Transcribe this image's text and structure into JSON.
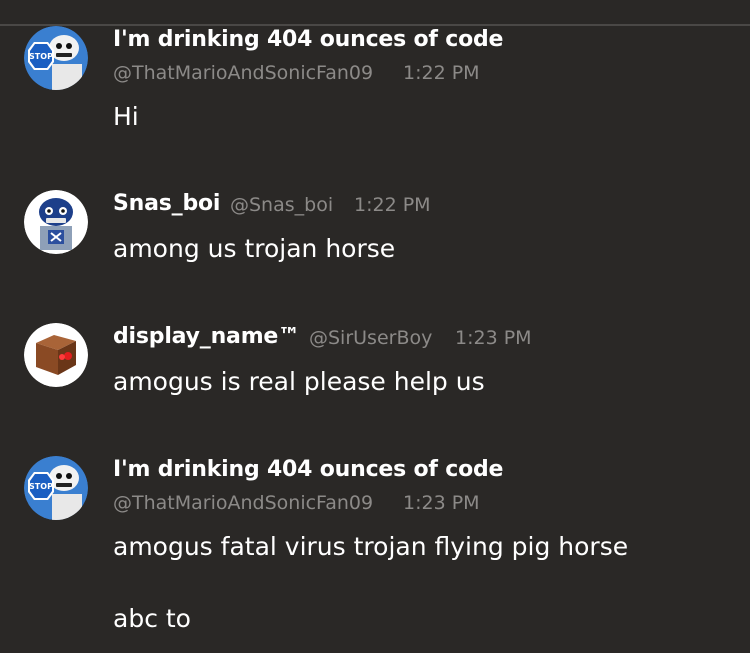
{
  "messages": [
    {
      "display_name": "I'm drinking 404 ounces of code",
      "handle": "@ThatMarioAndSonicFan09",
      "time": "1:22 PM",
      "lines": [
        "Hi"
      ],
      "avatar_icon": "stop-sign-skeleton-avatar-icon"
    },
    {
      "display_name": "Snas_boi",
      "handle": "@Snas_boi",
      "time": "1:22 PM",
      "lines": [
        "among us trojan horse"
      ],
      "avatar_icon": "blue-skeleton-avatar-icon"
    },
    {
      "display_name": "display_name™",
      "handle": "@SirUserBoy",
      "time": "1:23 PM",
      "lines": [
        "amogus is real please help us"
      ],
      "avatar_icon": "brown-box-avatar-icon"
    },
    {
      "display_name": "I'm drinking 404 ounces of code",
      "handle": "@ThatMarioAndSonicFan09",
      "time": "1:23 PM",
      "lines": [
        "amogus fatal virus trojan flying pig horse",
        "abc to"
      ],
      "avatar_icon": "stop-sign-skeleton-avatar-icon"
    }
  ],
  "colors": {
    "background": "#2a2826",
    "name": "#ffffff",
    "meta": "#8c8a88",
    "text": "#ffffff",
    "topbar_border": "#4a4846"
  }
}
